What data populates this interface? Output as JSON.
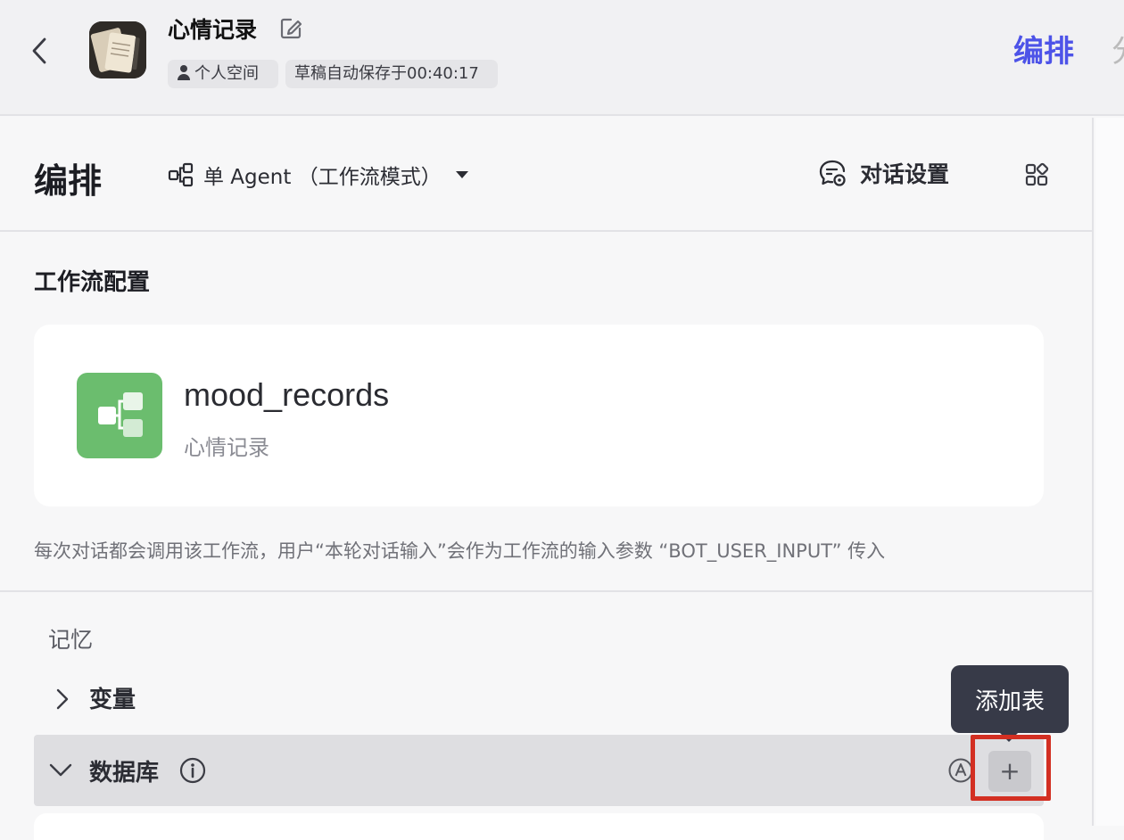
{
  "header": {
    "title": "心情记录",
    "space_label": "个人空间",
    "autosave_text": "草稿自动保存于00:40:17",
    "tab_arrange": "编排",
    "tab_cut": "分"
  },
  "toolbar": {
    "section_title": "编排",
    "mode_label": "单 Agent （工作流模式）",
    "chat_settings_label": "对话设置"
  },
  "workflow": {
    "section_label": "工作流配置",
    "name": "mood_records",
    "description": "心情记录",
    "note": "每次对话都会调用该工作流，用户“本轮对话输入”会作为工作流的输入参数 “BOT_USER_INPUT” 传入"
  },
  "memory": {
    "label": "记忆",
    "variables_label": "变量",
    "database_label": "数据库",
    "add_table_tooltip": "添加表",
    "add_symbol": "+"
  },
  "colors": {
    "accent": "#4d53e8",
    "workflow_icon_bg": "#6bbd6e",
    "highlight": "#d32f22",
    "tooltip_bg": "#373a48"
  }
}
